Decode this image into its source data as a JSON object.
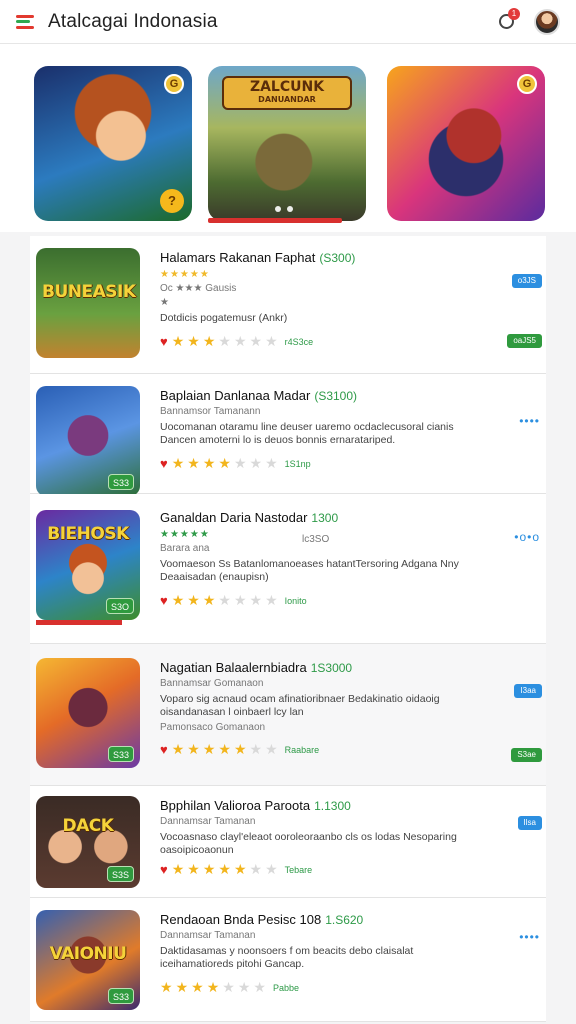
{
  "app": {
    "title": "Atalcagai Indonasia",
    "notification_count": "1"
  },
  "featured": {
    "cards": [
      {
        "label": ""
      },
      {
        "headline": "ZALCUNK",
        "subline": "DANUANDAR"
      },
      {
        "label": ""
      }
    ],
    "coin_label": "?",
    "badge_label": "G"
  },
  "colors": {
    "accent_red": "#d8302e",
    "accent_green": "#2e9a48",
    "accent_blue": "#2c8fe0"
  },
  "games": [
    {
      "name": "Halamars Rakanan Faphat",
      "count": "(S300)",
      "mini_stars": "★★★★★",
      "sub": "Oc ★★★ Gausis",
      "sub2": "★",
      "desc": "Dotdicis pogatemusr (Ankr)",
      "thumb_title": "BUNEASIK",
      "rating": 2.5,
      "rating_label": "r4S3ce",
      "side": "blue-pill",
      "side_label": "o3JS",
      "bottom_pill": "oaJS5"
    },
    {
      "name": "Baplaian Danlanaa Madar",
      "count": "(S3100)",
      "sub": "Bannamsor Tamanann",
      "desc": "Uocomanan otaramu line deuser uaremo ocdaclecusoral cianis Dancen amoterni lo is deuos bonnis ernaratariped.",
      "thumb_title": "",
      "thumb_tag": "S33",
      "rating": 4,
      "rating_label": "1S1np",
      "side": "more",
      "side_label": "••••"
    },
    {
      "name": "Ganaldan Daria Nastodar",
      "count": "1300",
      "mini_stars": "★★★★★",
      "sub": "Barara ana",
      "desc": "Voomaeson Ss Batanlomanoeases hatantTersoring Adgana Nny Deaaisadan (enaupisn)",
      "thumb_title": "BIEHOSK",
      "thumb_tag": "S3O",
      "rating": 3,
      "rating_label": "Ionito",
      "sub_right": "lc3SO",
      "side": "more",
      "side_label": "•o•o"
    },
    {
      "name": "Nagatian Balaalernbiadra",
      "count": "1S3000",
      "sub": "Bannamsar Gomanaon",
      "desc": "Voparo sig acnaud ocam afinatioribnaer Bedakinatio oidaoig oisandanasan l oinbaerl lcy lan",
      "sub3": "Pamonsaco Gomanaon",
      "thumb_title": "",
      "thumb_tag": "S33",
      "rating": 4.5,
      "rating_label": "Raabare",
      "side": "blue-pill",
      "side_label": "I3aa",
      "bottom_pill": "S3ae"
    },
    {
      "name": "Bpphilan Valioroa Paroota",
      "count": "1.1300",
      "sub": "Dannamsar Tamanan",
      "desc": "Vocoasnaso clayl'eleaot ooroleoraanbo cls os lodas Nesoparing oasoipicoaonun",
      "thumb_title": "DACK",
      "thumb_tag": "S3S",
      "rating": 4.5,
      "rating_label": "Tebare",
      "side": "blue-pill",
      "side_label": "Ilsa"
    },
    {
      "name": "Rendaoan Bnda Pesisc 108",
      "count": "1.S620",
      "sub": "Dannamsar Tamanan",
      "desc": "Daktidasamas y noonsoers f om beacits debo claisalat iceihamatioreds pitohi Gancap.",
      "thumb_title": "VAIONIU",
      "thumb_tag": "S33",
      "rating": 3.5,
      "rating_label": "Pabbe",
      "side": "more",
      "side_label": "••••"
    }
  ]
}
